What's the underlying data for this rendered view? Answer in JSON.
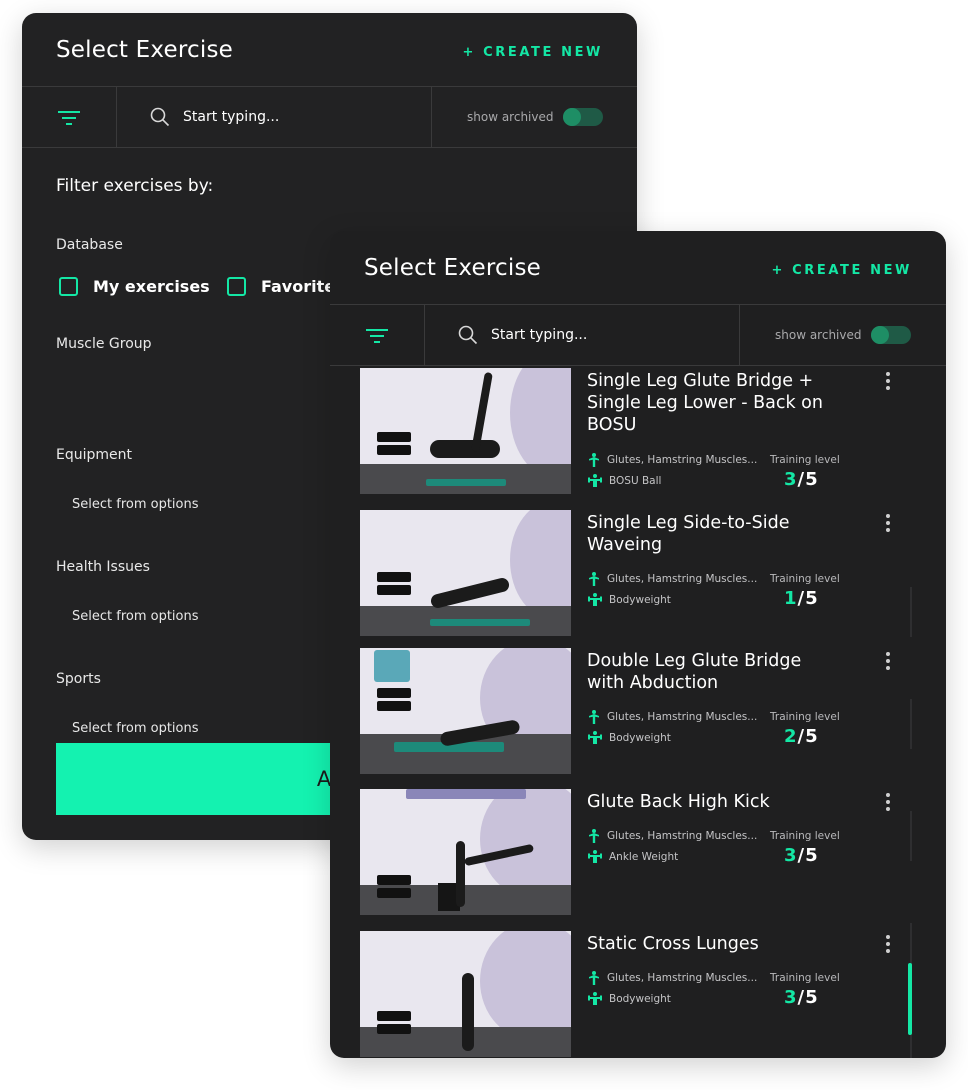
{
  "back_panel": {
    "title": "Select Exercise",
    "create_new": "+ CREATE NEW",
    "search_placeholder": "Start typing...",
    "show_archived": "show archived",
    "filter_heading": "Filter exercises by:",
    "database_label": "Database",
    "checkboxes": [
      "My exercises",
      "Favorites"
    ],
    "muscle_group_label": "Muscle Group",
    "equipment_label": "Equipment",
    "health_issues_label": "Health Issues",
    "sports_label": "Sports",
    "select_placeholder": "Select from options",
    "apply_label": "Apply"
  },
  "front_panel": {
    "title": "Select Exercise",
    "create_new": "+ CREATE NEW",
    "search_placeholder": "Start typing...",
    "show_archived": "show archived",
    "training_level_label": "Training level",
    "exercises": [
      {
        "name": "Single Leg Glute Bridge + Single Leg Lower - Back on BOSU",
        "muscles": "Glutes, Hamstring Muscles...",
        "equipment": "BOSU Ball",
        "level": "3",
        "max": "5"
      },
      {
        "name": "Single Leg Side-to-Side Waveing",
        "muscles": "Glutes, Hamstring Muscles...",
        "equipment": "Bodyweight",
        "level": "1",
        "max": "5"
      },
      {
        "name": "Double Leg Glute Bridge with Abduction",
        "muscles": "Glutes, Hamstring Muscles...",
        "equipment": "Bodyweight",
        "level": "2",
        "max": "5"
      },
      {
        "name": "Glute Back High Kick",
        "muscles": "Glutes, Hamstring Muscles...",
        "equipment": "Ankle Weight",
        "level": "3",
        "max": "5"
      },
      {
        "name": "Static Cross Lunges",
        "muscles": "Glutes, Hamstring Muscles...",
        "equipment": "Bodyweight",
        "level": "3",
        "max": "5"
      }
    ]
  },
  "colors": {
    "accent": "#14e7a5",
    "apply": "#14f2b0",
    "panel": "#222223"
  },
  "icons": [
    "filter-icon",
    "search-icon",
    "muscle-icon",
    "equipment-icon",
    "kebab-menu-icon"
  ]
}
